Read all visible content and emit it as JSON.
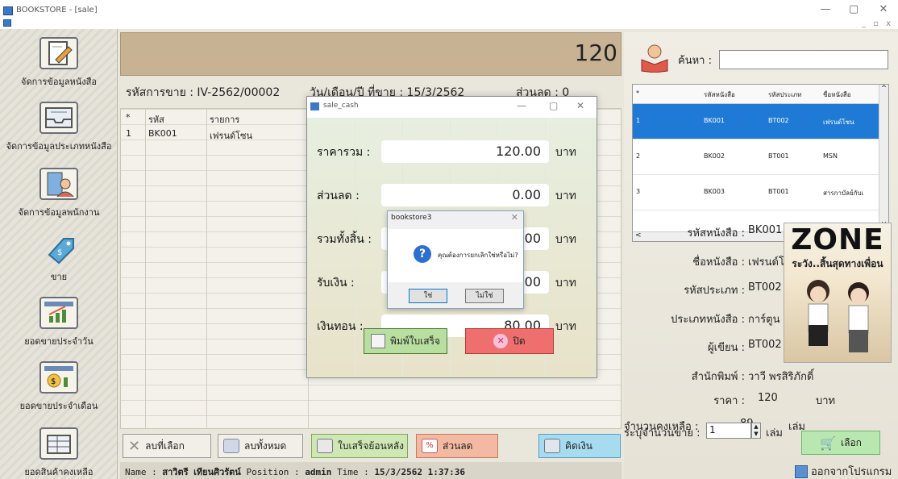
{
  "window": {
    "title": "BOOKSTORE - [sale]",
    "min_glyph": "—",
    "max_glyph": "▢",
    "close_glyph": "✕",
    "mdi_glyphs": "_ ▫ x"
  },
  "nav": {
    "items": [
      {
        "label": "จัดการข้อมูลหนังสือ",
        "icon": "book-edit-icon"
      },
      {
        "label": "จัดการข้อมูลประเภทหนังสือ",
        "icon": "inbox-tray-icon"
      },
      {
        "label": "จัดการข้อมูลพนักงาน",
        "icon": "employee-building-icon"
      },
      {
        "label": "ขาย",
        "icon": "price-tag-icon"
      },
      {
        "label": "ยอดขายประจำวัน",
        "icon": "daily-chart-icon"
      },
      {
        "label": "ยอดขายประจำเดือน",
        "icon": "monthly-money-chart-icon"
      },
      {
        "label": "ยอดสินค้าคงเหลือ",
        "icon": "stock-table-icon"
      }
    ]
  },
  "sale": {
    "total_display": "120",
    "sale_code_label": "รหัสการขาย : IV-2562/00002",
    "date_label": "วัน/เดือน/ปี ที่ขาย : 15/3/2562",
    "discount_label": "ส่วนลด : 0",
    "grid_headers": [
      "*",
      "รหัส",
      "รายการ"
    ],
    "grid_rows": [
      {
        "no": "1",
        "code": "BK001",
        "item": "เฟรนด์โซน"
      }
    ]
  },
  "bottom_buttons": {
    "delete_selected": "ลบที่เลือก",
    "delete_all": "ลบทั้งหมด",
    "reprint": "ใบเสร็จย้อนหลัง",
    "discount": "ส่วนลด",
    "checkout": "คิดเงิน"
  },
  "status_bar": {
    "name_label": "Name :",
    "name_value": "สาวิตรี เทียนศิวรัตน์",
    "position_label": "Position :",
    "position_value": "admin",
    "time_label": "Time :",
    "time_value": "15/3/2562 1:37:36"
  },
  "search": {
    "label": "ค้นหา :",
    "value": ""
  },
  "book_table": {
    "headers": [
      "*",
      "รหัสหนังสือ",
      "รหัสประเภท",
      "ชื่อหนังสือ"
    ],
    "rows": [
      {
        "no": "1",
        "code": "BK001",
        "type": "BT002",
        "name": "เฟรนด์โซน"
      },
      {
        "no": "2",
        "code": "BK002",
        "type": "BT001",
        "name": "MSN"
      },
      {
        "no": "3",
        "code": "BK003",
        "type": "BT001",
        "name": "สารกาบัลย์กับเ"
      }
    ],
    "scroll_up": "^",
    "scroll_down": "v",
    "scroll_left": "<",
    "scroll_right": ">"
  },
  "book_detail": {
    "code_label": "รหัสหนังสือ :",
    "code_value": "BK001",
    "name_label": "ชื่อหนังสือ :",
    "name_value": "เฟรนด์โซน",
    "type_code_label": "รหัสประเภท :",
    "type_code_value": "BT002",
    "type_label": "ประเภทหนังสือ :",
    "type_value": "การ์ตูน",
    "author_label": "ผู้เขียน :",
    "author_value": "BT002",
    "publisher_label": "สำนักพิมพ์ :",
    "publisher_value": "วาวี พรสิริภักดิ์",
    "price_label": "ราคา :",
    "price_value": "120",
    "price_unit": "บาท",
    "stock_label": "จำนวนคงเหลือ :",
    "stock_value": "89",
    "stock_unit": "เล่ม",
    "qty_label": "ระบุจำนวนขาย :",
    "qty_value": "1",
    "qty_unit": "เล่ม",
    "poster_title": "ZONE",
    "poster_subtitle": "ระวัง..สิ้นสุดทางเพื่อน"
  },
  "right_buttons": {
    "pick": "เลือก",
    "exit": "ออกจากโปรแกรม"
  },
  "cash_dialog": {
    "title": "sale_cash",
    "rows": [
      {
        "label": "ราคารวม :",
        "value": "120.00",
        "unit": "บาท"
      },
      {
        "label": "ส่วนลด :",
        "value": "0.00",
        "unit": "บาท"
      },
      {
        "label": "รวมทั้งสิ้น :",
        "value": "00",
        "unit": "บาท"
      },
      {
        "label": "รับเงิน :",
        "value": "00",
        "unit": "บาท"
      },
      {
        "label": "เงินทอน :",
        "value": "80.00",
        "unit": "บาท"
      }
    ],
    "print_button": "พิมพ์ใบเสร็จ",
    "close_button": "ปิด"
  },
  "confirm_box": {
    "title": "bookstore3",
    "message": "คุณต้องการยกเลิกใช่หรือไม่?",
    "yes": "ใช่",
    "no": "ไม่ใช่"
  },
  "colors": {
    "selected_row": "#1f7ad6",
    "top_bar": "#c7b293",
    "close_button": "#ef6f6f",
    "pick_button": "#b9e7b0"
  }
}
